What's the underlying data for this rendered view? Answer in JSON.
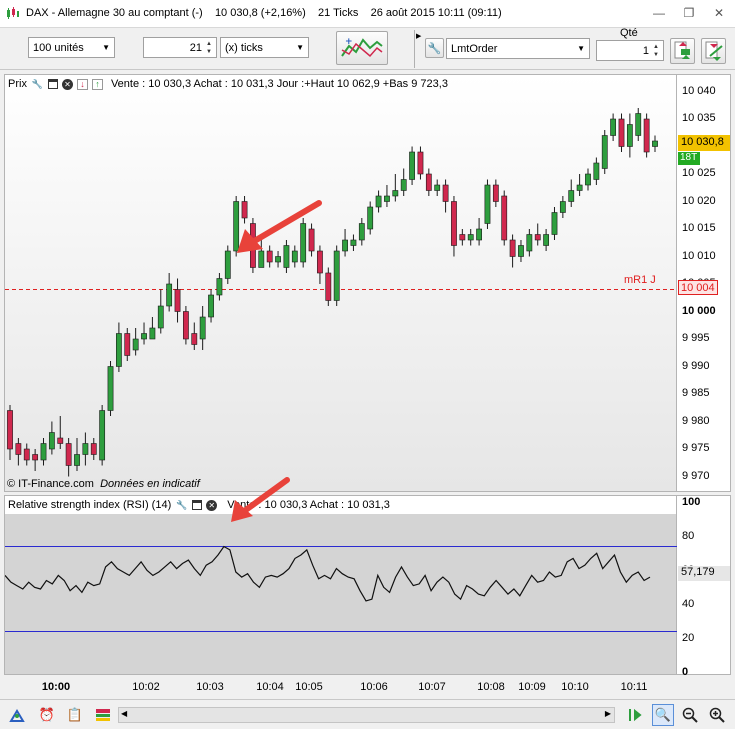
{
  "window": {
    "title": "DAX - Allemagne 30 au comptant (-)",
    "last_price": "10 030,8 (+2,16%)",
    "ticks": "21 Ticks",
    "datetime": "26 août 2015 10:11 (09:11)"
  },
  "toolbar": {
    "units": "100 unités",
    "period_value": "21",
    "period_unit": "(x) ticks",
    "qty_label": "Qté",
    "order_type": "LmtOrder",
    "quantity": "1"
  },
  "price_panel": {
    "title": "Prix",
    "info": "Vente : 10 030,3 Achat : 10 031,3 Jour :+Haut 10 062,9 +Bas 9 723,3",
    "copyright": "© IT-Finance.com",
    "disclaimer": "Données en indicatif",
    "level_label": "mR1 J",
    "level_value": "10 004",
    "current_price": "10 030,8",
    "tick_badge": "18T",
    "level_price": 10004,
    "y_ticks": [
      "10 040",
      "10 035",
      "10 030",
      "10 025",
      "10 020",
      "10 015",
      "10 010",
      "10 005",
      "10 000",
      "9 995",
      "9 990",
      "9 985",
      "9 980",
      "9 975",
      "9 970"
    ],
    "colors": {
      "up": "#2e9e3e",
      "down": "#d0284e",
      "current": "#f2c200",
      "badge": "#22aa22",
      "level": "#e02020",
      "annotation_arrow": "#e8423a"
    }
  },
  "rsi_panel": {
    "title": "Relative strength index (RSI) (14)",
    "info": "Vente : 10 030,3 Achat : 10 031,3",
    "current_value": "57,179",
    "upper_level": 75,
    "lower_level": 25,
    "y_ticks": [
      "100",
      "80",
      "60",
      "40",
      "20",
      "0"
    ]
  },
  "time_axis": {
    "labels": [
      "10:00",
      "10:02",
      "10:03",
      "10:04",
      "10:05",
      "10:06",
      "10:07",
      "10:08",
      "10:09",
      "10:10",
      "10:11"
    ]
  },
  "chart_data": {
    "type": "candlestick",
    "ylim": [
      9967,
      10043
    ],
    "candles": [
      {
        "o": 9982,
        "c": 9975,
        "h": 9983,
        "l": 9973
      },
      {
        "o": 9976,
        "c": 9974,
        "h": 9977,
        "l": 9972
      },
      {
        "o": 9975,
        "c": 9973,
        "h": 9976,
        "l": 9972
      },
      {
        "o": 9974,
        "c": 9973,
        "h": 9975,
        "l": 9971
      },
      {
        "o": 9973,
        "c": 9976,
        "h": 9977,
        "l": 9972
      },
      {
        "o": 9975,
        "c": 9978,
        "h": 9980,
        "l": 9974
      },
      {
        "o": 9977,
        "c": 9976,
        "h": 9981,
        "l": 9975
      },
      {
        "o": 9976,
        "c": 9972,
        "h": 9977,
        "l": 9970
      },
      {
        "o": 9972,
        "c": 9974,
        "h": 9977,
        "l": 9971
      },
      {
        "o": 9974,
        "c": 9976,
        "h": 9978,
        "l": 9972
      },
      {
        "o": 9976,
        "c": 9974,
        "h": 9977,
        "l": 9973
      },
      {
        "o": 9973,
        "c": 9982,
        "h": 9983,
        "l": 9972
      },
      {
        "o": 9982,
        "c": 9990,
        "h": 9991,
        "l": 9981
      },
      {
        "o": 9990,
        "c": 9996,
        "h": 9998,
        "l": 9989
      },
      {
        "o": 9996,
        "c": 9992,
        "h": 9997,
        "l": 9991
      },
      {
        "o": 9993,
        "c": 9995,
        "h": 9997,
        "l": 9992
      },
      {
        "o": 9995,
        "c": 9996,
        "h": 9998,
        "l": 9994
      },
      {
        "o": 9995,
        "c": 9997,
        "h": 9999,
        "l": 9995
      },
      {
        "o": 9997,
        "c": 10001,
        "h": 10004,
        "l": 9996
      },
      {
        "o": 10001,
        "c": 10005,
        "h": 10007,
        "l": 10000
      },
      {
        "o": 10004,
        "c": 10000,
        "h": 10006,
        "l": 9998
      },
      {
        "o": 10000,
        "c": 9995,
        "h": 10001,
        "l": 9994
      },
      {
        "o": 9996,
        "c": 9994,
        "h": 9998,
        "l": 9993
      },
      {
        "o": 9995,
        "c": 9999,
        "h": 10001,
        "l": 9993
      },
      {
        "o": 9999,
        "c": 10003,
        "h": 10004,
        "l": 9998
      },
      {
        "o": 10003,
        "c": 10006,
        "h": 10007,
        "l": 10002
      },
      {
        "o": 10006,
        "c": 10011,
        "h": 10012,
        "l": 10005
      },
      {
        "o": 10011,
        "c": 10020,
        "h": 10021,
        "l": 10010
      },
      {
        "o": 10020,
        "c": 10017,
        "h": 10021,
        "l": 10016
      },
      {
        "o": 10016,
        "c": 10008,
        "h": 10017,
        "l": 10007
      },
      {
        "o": 10008,
        "c": 10011,
        "h": 10013,
        "l": 10008
      },
      {
        "o": 10011,
        "c": 10009,
        "h": 10012,
        "l": 10008
      },
      {
        "o": 10009,
        "c": 10010,
        "h": 10011,
        "l": 10008
      },
      {
        "o": 10008,
        "c": 10012,
        "h": 10013,
        "l": 10007
      },
      {
        "o": 10009,
        "c": 10011,
        "h": 10012,
        "l": 10008
      },
      {
        "o": 10009,
        "c": 10016,
        "h": 10017,
        "l": 10008
      },
      {
        "o": 10015,
        "c": 10011,
        "h": 10016,
        "l": 10010
      },
      {
        "o": 10011,
        "c": 10007,
        "h": 10012,
        "l": 10005
      },
      {
        "o": 10007,
        "c": 10002,
        "h": 10008,
        "l": 10001
      },
      {
        "o": 10002,
        "c": 10011,
        "h": 10012,
        "l": 10001
      },
      {
        "o": 10011,
        "c": 10013,
        "h": 10015,
        "l": 10010
      },
      {
        "o": 10012,
        "c": 10013,
        "h": 10014,
        "l": 10011
      },
      {
        "o": 10013,
        "c": 10016,
        "h": 10017,
        "l": 10012
      },
      {
        "o": 10015,
        "c": 10019,
        "h": 10020,
        "l": 10014
      },
      {
        "o": 10019,
        "c": 10021,
        "h": 10022,
        "l": 10018
      },
      {
        "o": 10020,
        "c": 10021,
        "h": 10023,
        "l": 10019
      },
      {
        "o": 10021,
        "c": 10022,
        "h": 10025,
        "l": 10020
      },
      {
        "o": 10022,
        "c": 10024,
        "h": 10026,
        "l": 10021
      },
      {
        "o": 10024,
        "c": 10029,
        "h": 10030,
        "l": 10023
      },
      {
        "o": 10029,
        "c": 10025,
        "h": 10030,
        "l": 10024
      },
      {
        "o": 10025,
        "c": 10022,
        "h": 10026,
        "l": 10021
      },
      {
        "o": 10022,
        "c": 10023,
        "h": 10024,
        "l": 10021
      },
      {
        "o": 10023,
        "c": 10020,
        "h": 10024,
        "l": 10018
      },
      {
        "o": 10020,
        "c": 10012,
        "h": 10021,
        "l": 10010
      },
      {
        "o": 10014,
        "c": 10013,
        "h": 10015,
        "l": 10012
      },
      {
        "o": 10013,
        "c": 10014,
        "h": 10015,
        "l": 10012
      },
      {
        "o": 10013,
        "c": 10015,
        "h": 10017,
        "l": 10012
      },
      {
        "o": 10016,
        "c": 10023,
        "h": 10024,
        "l": 10015
      },
      {
        "o": 10023,
        "c": 10020,
        "h": 10024,
        "l": 10019
      },
      {
        "o": 10021,
        "c": 10013,
        "h": 10022,
        "l": 10012
      },
      {
        "o": 10013,
        "c": 10010,
        "h": 10014,
        "l": 10008
      },
      {
        "o": 10010,
        "c": 10012,
        "h": 10013,
        "l": 10009
      },
      {
        "o": 10011,
        "c": 10014,
        "h": 10015,
        "l": 10010
      },
      {
        "o": 10014,
        "c": 10013,
        "h": 10016,
        "l": 10012
      },
      {
        "o": 10012,
        "c": 10014,
        "h": 10015,
        "l": 10011
      },
      {
        "o": 10014,
        "c": 10018,
        "h": 10019,
        "l": 10013
      },
      {
        "o": 10018,
        "c": 10020,
        "h": 10021,
        "l": 10017
      },
      {
        "o": 10020,
        "c": 10022,
        "h": 10024,
        "l": 10019
      },
      {
        "o": 10022,
        "c": 10023,
        "h": 10025,
        "l": 10021
      },
      {
        "o": 10023,
        "c": 10025,
        "h": 10026,
        "l": 10022
      },
      {
        "o": 10024,
        "c": 10027,
        "h": 10028,
        "l": 10023
      },
      {
        "o": 10026,
        "c": 10032,
        "h": 10033,
        "l": 10025
      },
      {
        "o": 10032,
        "c": 10035,
        "h": 10036,
        "l": 10031
      },
      {
        "o": 10035,
        "c": 10030,
        "h": 10036,
        "l": 10029
      },
      {
        "o": 10030,
        "c": 10034,
        "h": 10036,
        "l": 10028
      },
      {
        "o": 10032,
        "c": 10036,
        "h": 10037,
        "l": 10031
      },
      {
        "o": 10035,
        "c": 10029,
        "h": 10036,
        "l": 10028
      },
      {
        "o": 10030,
        "c": 10031,
        "h": 10032,
        "l": 10029
      }
    ],
    "rsi": {
      "ylim": [
        0,
        100
      ],
      "values": [
        58,
        54,
        52,
        50,
        54,
        51,
        50,
        55,
        53,
        58,
        55,
        49,
        52,
        48,
        54,
        52,
        53,
        63,
        66,
        62,
        60,
        58,
        62,
        66,
        61,
        58,
        60,
        63,
        66,
        62,
        65,
        67,
        62,
        58,
        64,
        66,
        70,
        75,
        73,
        60,
        57,
        59,
        54,
        51,
        57,
        58,
        57,
        59,
        62,
        68,
        70,
        73,
        64,
        56,
        58,
        56,
        62,
        59,
        57,
        56,
        49,
        43,
        44,
        58,
        51,
        48,
        57,
        63,
        57,
        52,
        53,
        58,
        49,
        54,
        57,
        54,
        47,
        44,
        52,
        50,
        47,
        46,
        51,
        55,
        51,
        47,
        50,
        46,
        52,
        58,
        54,
        55,
        60,
        57,
        58,
        66,
        68,
        62,
        64,
        68,
        71,
        62,
        66,
        70,
        60,
        54,
        58,
        60,
        55,
        57
      ]
    }
  }
}
